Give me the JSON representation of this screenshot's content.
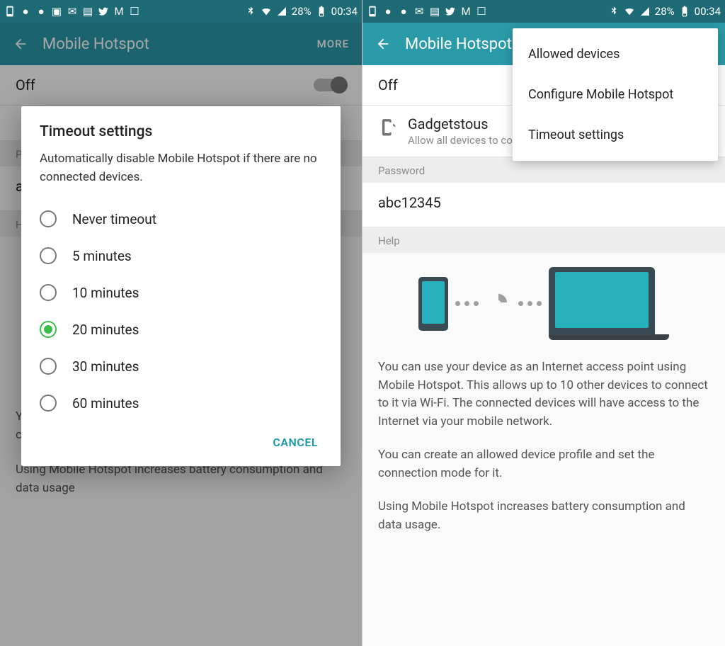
{
  "status": {
    "battery_pct": "28%",
    "time": "00:34"
  },
  "toolbar": {
    "title": "Mobile Hotspot",
    "more": "MORE"
  },
  "hotspot": {
    "off_label": "Off",
    "name": "Gadgetstous",
    "sub": "Allow all devices to connect."
  },
  "sections": {
    "password": "Password",
    "help": "Help"
  },
  "password_value": "abc12345",
  "help": {
    "p1": "You can use your device as an Internet access point using Mobile Hotspot. This allows up to 10 other devices to connect to it via Wi-Fi. The connected devices will have access to the Internet via your mobile network.",
    "p2": "You can create an allowed device profile and set the connection mode for it.",
    "p3": "Using Mobile Hotspot increases battery consumption and data usage."
  },
  "menu": {
    "items": [
      "Allowed devices",
      "Configure Mobile Hotspot",
      "Timeout settings"
    ]
  },
  "dialog": {
    "title": "Timeout settings",
    "desc": "Automatically disable Mobile Hotspot if there are no connected devices.",
    "options": [
      "Never timeout",
      "5 minutes",
      "10 minutes",
      "20 minutes",
      "30 minutes",
      "60 minutes"
    ],
    "selected_index": 3,
    "cancel": "CANCEL"
  },
  "left_bg": {
    "pa_prefix": "Pa",
    "ab_prefix": "ab",
    "he_prefix": "He",
    "cut1": "You can create an allowed device profile and set the connection mode for it.",
    "cut2": "Using Mobile Hotspot increases battery consumption and data usage"
  }
}
